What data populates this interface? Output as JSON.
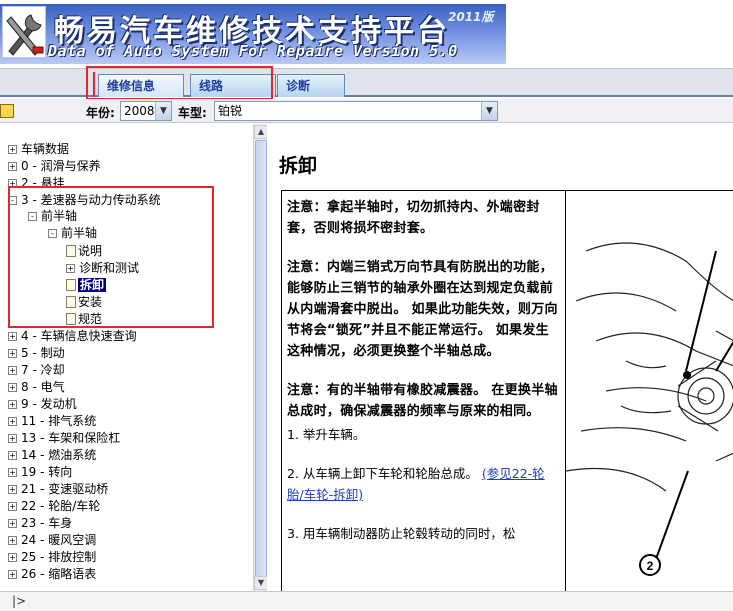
{
  "banner": {
    "title": "畅易汽车维修技术支持平台",
    "year_badge": "2011版",
    "subtitle": "Data of Auto System For Repaire Version 5.0"
  },
  "tabs": [
    {
      "label": "维修信息",
      "active": true
    },
    {
      "label": "线路",
      "active": false
    },
    {
      "label": "诊断",
      "active": false
    }
  ],
  "toolbar": {
    "year_label": "年份:",
    "year_value": "2008",
    "model_label": "车型:",
    "model_value": "铂锐"
  },
  "tree": [
    {
      "label": "车辆数据",
      "expander": "+"
    },
    {
      "label": "0 - 润滑与保养",
      "expander": "+"
    },
    {
      "label": "2 - 悬挂",
      "expander": "+"
    },
    {
      "label": "3 - 差速器与动力传动系统",
      "expander": "-"
    },
    {
      "label": "前半轴",
      "expander": "-"
    },
    {
      "label": "前半轴",
      "expander": "-"
    },
    {
      "label": "说明",
      "expander": ""
    },
    {
      "label": "诊断和测试",
      "expander": "+"
    },
    {
      "label": "拆卸",
      "expander": "",
      "selected": true
    },
    {
      "label": "安装",
      "expander": ""
    },
    {
      "label": "规范",
      "expander": ""
    },
    {
      "label": "4 - 车辆信息快速查询",
      "expander": "+"
    },
    {
      "label": "5 - 制动",
      "expander": "+"
    },
    {
      "label": "7 - 冷却",
      "expander": "+"
    },
    {
      "label": "8 - 电气",
      "expander": "+"
    },
    {
      "label": "9 - 发动机",
      "expander": "+"
    },
    {
      "label": "11 - 排气系统",
      "expander": "+"
    },
    {
      "label": "13 - 车架和保险杠",
      "expander": "+"
    },
    {
      "label": "14 - 燃油系统",
      "expander": "+"
    },
    {
      "label": "19 - 转向",
      "expander": "+"
    },
    {
      "label": "21 - 变速驱动桥",
      "expander": "+"
    },
    {
      "label": "22 - 轮胎/车轮",
      "expander": "+"
    },
    {
      "label": "23 - 车身",
      "expander": "+"
    },
    {
      "label": "24 - 暖风空调",
      "expander": "+"
    },
    {
      "label": "25 - 排放控制",
      "expander": "+"
    },
    {
      "label": "26 - 缩略语表",
      "expander": "+"
    }
  ],
  "content": {
    "heading": "拆卸",
    "note1": "注意：拿起半轴时，切勿抓持内、外端密封套，否则将损坏密封套。",
    "note2": "注意：内端三销式万向节具有防脱出的功能，能够防止三销节的轴承外圈在达到规定负载前从内端滑套中脱出。 如果此功能失效，则万向节将会“锁死”并且不能正常运行。 如果发生这种情况，必须更换整个半轴总成。",
    "note3": "注意：有的半轴带有橡胶减震器。 在更换半轴总成时，确保减震器的频率与原来的相同。",
    "step1": "1. 举升车辆。",
    "step2_prefix": "2. 从车辆上卸下车轮和轮胎总成。",
    "step2_link": "(参见22-轮胎/车轮-拆卸)",
    "step3": "3. 用车辆制动器防止轮毂转动的同时，松",
    "figure_callout": "2"
  },
  "status": {
    "arrow": "|>"
  }
}
